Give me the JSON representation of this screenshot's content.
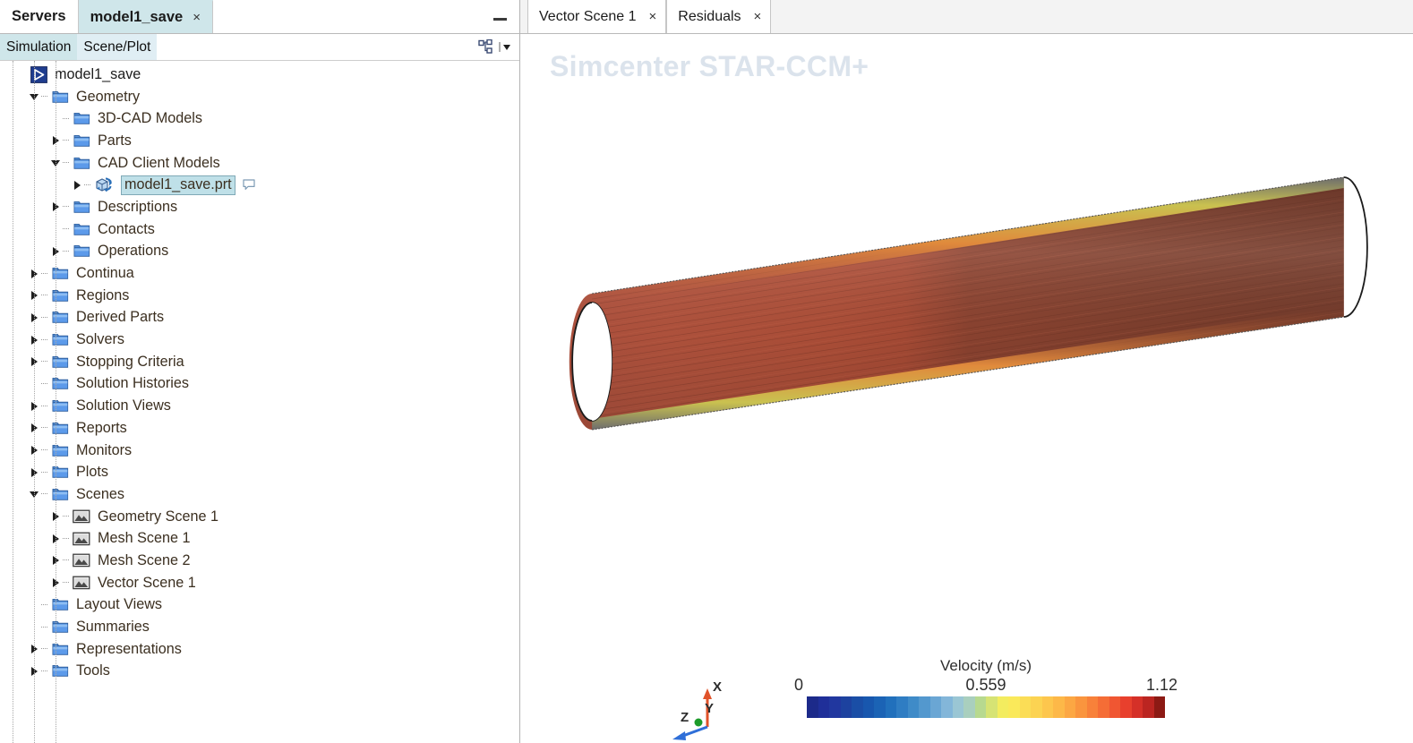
{
  "window": {
    "tabs": [
      {
        "label": "Servers",
        "active": false,
        "closable": false
      },
      {
        "label": "model1_save",
        "active": true,
        "closable": true,
        "close_glyph": "×"
      }
    ],
    "minimize_label": "–"
  },
  "explorer": {
    "subtabs": [
      {
        "label": "Simulation",
        "selected": true
      },
      {
        "label": "Scene/Plot",
        "selected": false
      }
    ],
    "toolbar_icons": [
      {
        "name": "tree-hierarchy-icon"
      },
      {
        "name": "dropdown-arrow-icon"
      }
    ],
    "tree": [
      {
        "label": "model1_save",
        "depth": 0,
        "icon": "simulation-icon",
        "twisty": "none",
        "selected": false
      },
      {
        "label": "Geometry",
        "depth": 1,
        "icon": "folder-icon",
        "twisty": "expanded",
        "selected": false
      },
      {
        "label": "3D-CAD Models",
        "depth": 2,
        "icon": "folder-icon",
        "twisty": "none",
        "selected": false
      },
      {
        "label": "Parts",
        "depth": 2,
        "icon": "folder-icon",
        "twisty": "collapsed",
        "selected": false
      },
      {
        "label": "CAD Client Models",
        "depth": 2,
        "icon": "folder-icon",
        "twisty": "expanded",
        "selected": false
      },
      {
        "label": "model1_save.prt",
        "depth": 3,
        "icon": "cad-part-icon",
        "twisty": "collapsed",
        "selected": true,
        "comment": true
      },
      {
        "label": "Descriptions",
        "depth": 2,
        "icon": "folder-icon",
        "twisty": "collapsed",
        "selected": false
      },
      {
        "label": "Contacts",
        "depth": 2,
        "icon": "folder-icon",
        "twisty": "none",
        "selected": false
      },
      {
        "label": "Operations",
        "depth": 2,
        "icon": "folder-icon",
        "twisty": "collapsed",
        "selected": false
      },
      {
        "label": "Continua",
        "depth": 1,
        "icon": "folder-icon",
        "twisty": "collapsed",
        "selected": false
      },
      {
        "label": "Regions",
        "depth": 1,
        "icon": "folder-icon",
        "twisty": "collapsed",
        "selected": false
      },
      {
        "label": "Derived Parts",
        "depth": 1,
        "icon": "folder-icon",
        "twisty": "collapsed",
        "selected": false
      },
      {
        "label": "Solvers",
        "depth": 1,
        "icon": "folder-icon",
        "twisty": "collapsed",
        "selected": false
      },
      {
        "label": "Stopping Criteria",
        "depth": 1,
        "icon": "folder-icon",
        "twisty": "collapsed",
        "selected": false
      },
      {
        "label": "Solution Histories",
        "depth": 1,
        "icon": "folder-icon",
        "twisty": "none",
        "selected": false
      },
      {
        "label": "Solution Views",
        "depth": 1,
        "icon": "folder-icon",
        "twisty": "collapsed",
        "selected": false
      },
      {
        "label": "Reports",
        "depth": 1,
        "icon": "folder-icon",
        "twisty": "collapsed",
        "selected": false
      },
      {
        "label": "Monitors",
        "depth": 1,
        "icon": "folder-icon",
        "twisty": "collapsed",
        "selected": false
      },
      {
        "label": "Plots",
        "depth": 1,
        "icon": "folder-icon",
        "twisty": "collapsed",
        "selected": false
      },
      {
        "label": "Scenes",
        "depth": 1,
        "icon": "folder-icon",
        "twisty": "expanded",
        "selected": false
      },
      {
        "label": "Geometry Scene 1",
        "depth": 2,
        "icon": "scene-icon",
        "twisty": "collapsed",
        "selected": false
      },
      {
        "label": "Mesh Scene 1",
        "depth": 2,
        "icon": "scene-icon",
        "twisty": "collapsed",
        "selected": false
      },
      {
        "label": "Mesh Scene 2",
        "depth": 2,
        "icon": "scene-icon",
        "twisty": "collapsed",
        "selected": false
      },
      {
        "label": "Vector Scene 1",
        "depth": 2,
        "icon": "scene-icon",
        "twisty": "collapsed",
        "selected": false
      },
      {
        "label": "Layout Views",
        "depth": 1,
        "icon": "folder-icon",
        "twisty": "none",
        "selected": false
      },
      {
        "label": "Summaries",
        "depth": 1,
        "icon": "folder-icon",
        "twisty": "none",
        "selected": false
      },
      {
        "label": "Representations",
        "depth": 1,
        "icon": "folder-icon",
        "twisty": "collapsed",
        "selected": false
      },
      {
        "label": "Tools",
        "depth": 1,
        "icon": "folder-icon",
        "twisty": "collapsed",
        "selected": false
      }
    ]
  },
  "scene_area": {
    "tabs": [
      {
        "label": "Vector Scene 1",
        "active": true,
        "close_glyph": "×"
      },
      {
        "label": "Residuals",
        "active": false,
        "close_glyph": "×"
      }
    ],
    "watermark": "Simcenter STAR-CCM+",
    "triad": {
      "x_label": "X",
      "y_label": "Y",
      "z_label": "Z",
      "x_color": "#e0532a",
      "y_color": "#1d9b2a",
      "z_color": "#2f6fd8"
    }
  },
  "chart_data": {
    "type": "colorbar",
    "title": "Velocity (m/s)",
    "field": "Velocity",
    "unit": "m/s",
    "min_label": "0",
    "mid_label": "0.559",
    "max_label": "1.12",
    "min": 0,
    "mid": 0.559,
    "max": 1.12,
    "ticks": [
      "0",
      "0.559",
      "1.12"
    ],
    "colormap_name": "blue-red",
    "n_bands": 32,
    "colors": [
      "#1c2a8a",
      "#1f2f99",
      "#21379f",
      "#1d429f",
      "#1a4ea6",
      "#1857ae",
      "#1b63b5",
      "#2170bc",
      "#2f7dc3",
      "#3f8bc8",
      "#5398ce",
      "#6aa6d4",
      "#83b6d9",
      "#9ac6d4",
      "#a9cfbe",
      "#b7d98f",
      "#d6e374",
      "#f3ec5f",
      "#fae95a",
      "#fbdd56",
      "#fcd352",
      "#fdc64d",
      "#fdb848",
      "#fca743",
      "#fa953e",
      "#f8813a",
      "#f56d36",
      "#f05632",
      "#e8402d",
      "#d53028",
      "#bb2521",
      "#8c1a14"
    ]
  }
}
